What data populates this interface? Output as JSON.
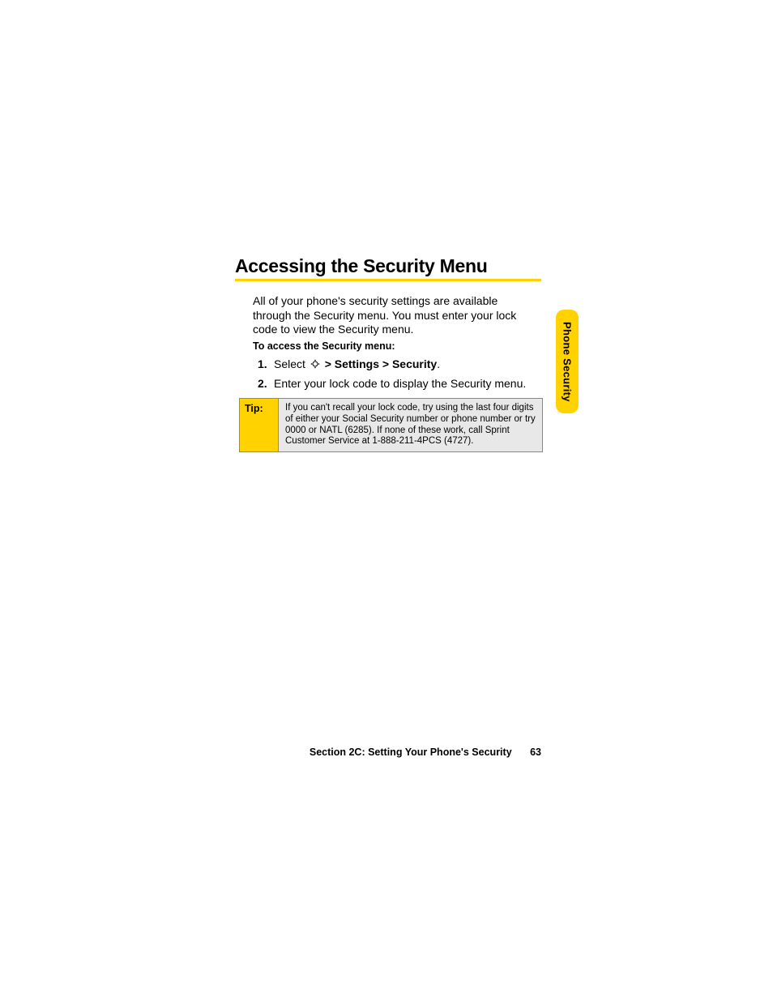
{
  "heading": "Accessing the Security Menu",
  "intro": "All of your phone's security settings are available through the Security menu. You must enter your lock code to view the Security menu.",
  "instruction_heading": "To access the Security menu:",
  "steps": {
    "s1_number": "1.",
    "s1_prefix": "Select ",
    "s1_bold": " > Settings > Security",
    "s1_suffix": ".",
    "s2_number": "2.",
    "s2_text": "Enter your lock code to display the Security menu."
  },
  "tip": {
    "label": "Tip:",
    "content": "If you can't recall your lock code, try using the last four digits of either your Social Security number or phone number or try 0000 or NATL (6285). If none of these work, call Sprint Customer Service at 1-888-211-4PCS (4727)."
  },
  "side_tab": "Phone Security",
  "footer": {
    "section": "Section 2C: Setting Your Phone's Security",
    "page": "63"
  }
}
